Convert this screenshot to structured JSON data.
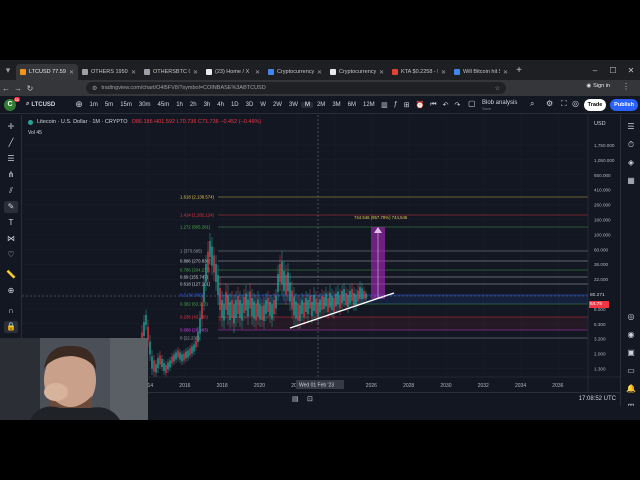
{
  "browser": {
    "tabs": [
      {
        "label": "LTCUSD 77.594",
        "color": "#f7931a",
        "active": true
      },
      {
        "label": "OTHERS 1950",
        "color": "#9aa0a6"
      },
      {
        "label": "OTHERSBTC 0.110",
        "color": "#9aa0a6"
      },
      {
        "label": "(23) Home / X",
        "color": "#e8eaed"
      },
      {
        "label": "Cryptocurrency P",
        "color": "#4285f4"
      },
      {
        "label": "Cryptocurrency Li",
        "color": "#e8eaed"
      },
      {
        "label": "KTA $0.2258 - Ken",
        "color": "#db4437"
      },
      {
        "label": "Will Bitcoin hit $8",
        "color": "#4285f4"
      }
    ],
    "url": "tradingview.com/chart/O4l5FV8/?symbol=COINBASE%3ABTCUSD",
    "signin_label": "Sign in",
    "new_tab_label": "+"
  },
  "toolbar": {
    "logo_text": "C",
    "badge": "11",
    "symbol": "LTCUSD",
    "intervals": [
      "1m",
      "5m",
      "15m",
      "30m",
      "45m",
      "1h",
      "2h",
      "3h",
      "4h",
      "1D",
      "3D",
      "W",
      "2W",
      "3W",
      "M",
      "2M",
      "3M",
      "6M",
      "12M"
    ],
    "selected_interval": "M",
    "layout_name": "Blob analysis",
    "layout_sub": "Save",
    "trade_label": "Trade",
    "publish_label": "Publish"
  },
  "chart": {
    "pair": "Litecoin · U.S. Dollar · 1M · CRYPTO",
    "ohlc": "O86.186 H01.592 L70.736 C71.736 −0.452 (−0.46%)",
    "volume_label": "Vol 45",
    "currency": "USD",
    "fib_levels": [
      {
        "label": "1.618 (2,138.574)",
        "color": "#e6c84f"
      },
      {
        "label": "1.414 (1,282.124)",
        "color": "#f23645"
      },
      {
        "label": "1.272 (805.261)",
        "color": "#4caf50"
      },
      {
        "label": "1 (373.695)",
        "color": "#9aa0a6"
      },
      {
        "label": "0.886 (270.838)",
        "color": "#d1d4dc"
      },
      {
        "label": "0.786 (204.237)",
        "color": "#4caf50"
      },
      {
        "label": "0.69 (155.747)",
        "color": "#d1d4dc"
      },
      {
        "label": "0.618 (127.101)",
        "color": "#d1d4dc"
      },
      {
        "label": "0.5 (90.085)",
        "color": "#2962ff"
      },
      {
        "label": "0.382 (63.203)",
        "color": "#4caf50"
      },
      {
        "label": "0.236 (43.236)",
        "color": "#f23645"
      },
      {
        "label": "0.068 (26.983)",
        "color": "#e040fb"
      },
      {
        "label": "0 (22.239)",
        "color": "#9aa0a6"
      }
    ],
    "projection_label": "744.546 (957.78%) 744,546",
    "price_ticks": [
      "1,750.000",
      "1,050.000",
      "650.000",
      "410.000",
      "260.000",
      "160.000",
      "100.000",
      "60.000",
      "36.000",
      "22.000",
      "14.000",
      "8.000",
      "5.300",
      "3.200",
      "2.000",
      "1.300"
    ],
    "current_price": "80.271",
    "price_tag_2": "64.75",
    "year_ticks": [
      "2014",
      "2016",
      "2018",
      "2020",
      "2022",
      "2024",
      "2026",
      "2028",
      "2030",
      "2032",
      "2034",
      "2036"
    ],
    "crosshair_date": "Wed 01 Feb '23",
    "clock": "17:08:52 UTC",
    "accent_up": "#26a69a",
    "accent_down": "#f23645"
  }
}
